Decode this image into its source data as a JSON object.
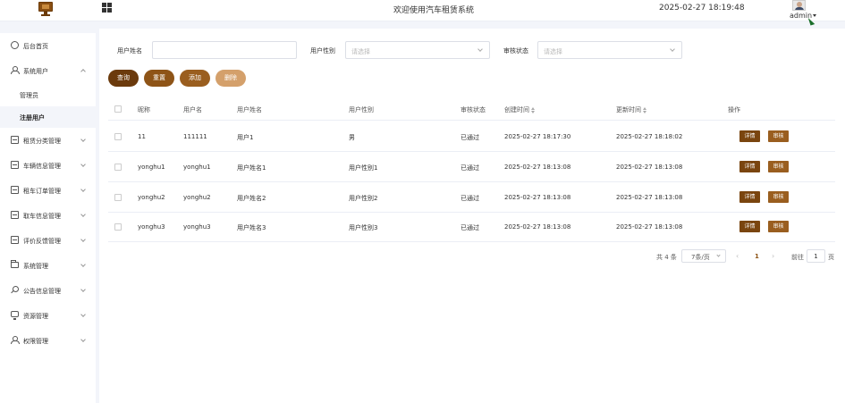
{
  "header": {
    "title": "欢迎使用汽车租赁系统",
    "datetime": "2025-02-27 18:19:48",
    "username": "admin"
  },
  "sidebar": {
    "items": [
      {
        "label": "后台首页",
        "icon": "home-icon"
      },
      {
        "label": "系统用户",
        "icon": "user-icon",
        "expanded": true
      },
      {
        "label": "租赁分类管理",
        "icon": "folder-icon"
      },
      {
        "label": "车辆信息管理",
        "icon": "folder-icon"
      },
      {
        "label": "租车订单管理",
        "icon": "folder-icon"
      },
      {
        "label": "取车信息管理",
        "icon": "folder-icon"
      },
      {
        "label": "评价反馈管理",
        "icon": "folder-icon"
      },
      {
        "label": "系统管理",
        "icon": "folder-icon"
      },
      {
        "label": "公告信息管理",
        "icon": "search-icon"
      },
      {
        "label": "资源管理",
        "icon": "monitor-icon"
      },
      {
        "label": "权限管理",
        "icon": "user-icon"
      }
    ],
    "sub_items": [
      {
        "label": "管理员"
      },
      {
        "label": "注册用户",
        "active": true
      }
    ]
  },
  "filters": {
    "name_label": "用户姓名",
    "name_value": "",
    "gender_label": "用户性别",
    "gender_placeholder": "请选择",
    "status_label": "审核状态",
    "status_placeholder": "请选择"
  },
  "buttons": {
    "query": "查询",
    "reset": "重置",
    "add": "添加",
    "delete": "删除"
  },
  "table": {
    "headers": [
      "昵称",
      "用户名",
      "用户姓名",
      "用户性别",
      "审核状态",
      "创建时间",
      "更新时间",
      "操作"
    ],
    "rows": [
      [
        "11",
        "111111",
        "用户1",
        "男",
        "已通过",
        "2025-02-27 18:17:30",
        "2025-02-27 18:18:02"
      ],
      [
        "yonghu1",
        "yonghu1",
        "用户姓名1",
        "用户性别1",
        "已通过",
        "2025-02-27 18:13:08",
        "2025-02-27 18:13:08"
      ],
      [
        "yonghu2",
        "yonghu2",
        "用户姓名2",
        "用户性别2",
        "已通过",
        "2025-02-27 18:13:08",
        "2025-02-27 18:13:08"
      ],
      [
        "yonghu3",
        "yonghu3",
        "用户姓名3",
        "用户性别3",
        "已通过",
        "2025-02-27 18:13:08",
        "2025-02-27 18:13:08"
      ]
    ],
    "detail_label": "详情",
    "audit_label": "审核"
  },
  "pagination": {
    "total": "共 4 条",
    "page_size": "7条/页",
    "prev": "‹",
    "current": "1",
    "next": "›",
    "goto": "前往",
    "jump_value": "1",
    "page_suffix": "页"
  },
  "colors": {
    "primary_dark": "#6b3a0c",
    "primary": "#8e5417",
    "primary_light": "#d4a06b"
  }
}
